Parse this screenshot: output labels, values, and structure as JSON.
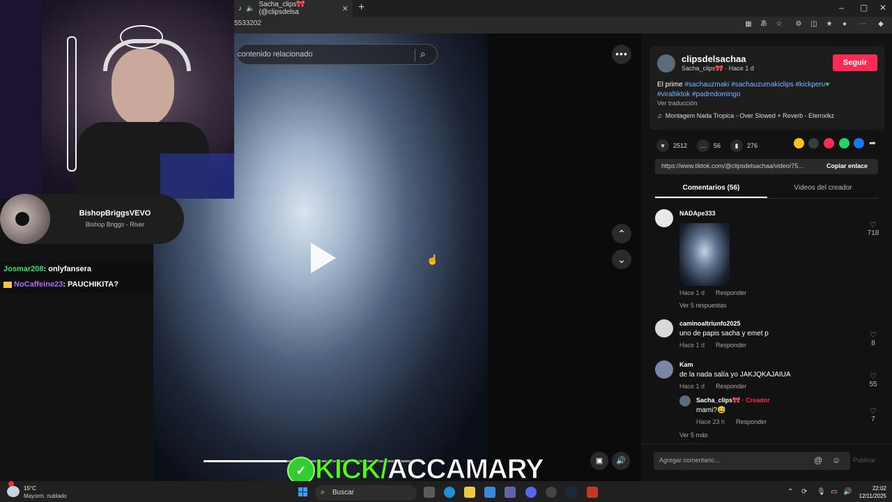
{
  "browser": {
    "tab_title": "Sacha_clips🎀 (@clipsdelsa",
    "new_tab_symbol": "+",
    "window_controls": [
      "–",
      "▢",
      "✕"
    ],
    "url_fragment": "5533202"
  },
  "video": {
    "search_placeholder": "contenido relacionado",
    "more_label": "•••",
    "nav_up": "⌃",
    "nav_down": "⌄",
    "progress_fraction": 0.39
  },
  "overlay": {
    "music_title": "BishopBriggsVEVO",
    "music_artist": "Bishop Briggs - River",
    "chat": [
      {
        "user": "Josmar208",
        "message": ": onlyfansera"
      },
      {
        "user": "NoCaffeine23",
        "message": ": PAUCHIKITA?"
      }
    ],
    "kick_prefix": "KICK/",
    "kick_channel": "ACCAMARY"
  },
  "post": {
    "author": "clipsdelsachaa",
    "author_sub": "Sacha_clips🎀 · Hace 1 d",
    "follow_label": "Seguir",
    "desc_text": "El prime ",
    "hashtags": [
      "#sachauzmaki",
      "#sachauzumakiclips",
      "#kickperu"
    ],
    "hashtags_line2": [
      "#viraltiktok",
      "#padredomingo"
    ],
    "translate_label": "Ver traducción",
    "music": "Montagem Nada Tropica - Over Slowed + Reverb - Eternxlkz",
    "likes": "2512",
    "comments": "56",
    "saves": "276",
    "link": "https://www.tiktok.com/@clipsdelsachaa/video/75...",
    "copy_label": "Copiar enlace",
    "tab_comments": "Comentarios (56)",
    "tab_videos": "Videos del creador"
  },
  "comments": [
    {
      "user": "NADApe333",
      "meta_time": "Hace 1 d",
      "reply": "Responder",
      "likes": "718",
      "more": "Ver 5 respuestas"
    },
    {
      "user": "caminoaltriunfo2025",
      "text": "uno de papis sacha y emet p",
      "meta_time": "Hace 1 d",
      "reply": "Responder",
      "likes": "8"
    },
    {
      "user": "Kam",
      "text": "de la nada salía yo JAKJQKAJAIUA",
      "meta_time": "Hace 1 d",
      "reply": "Responder",
      "likes": "55"
    },
    {
      "user": "Sacha_clips🎀",
      "creator_tag": " · Creador",
      "text": "mami?😅",
      "meta_time": "Hace 23 h",
      "reply": "Responder",
      "likes": "7",
      "more": "Ver 5 más"
    }
  ],
  "comment_box": {
    "placeholder": "Agregar comentario...",
    "publish_label": "Publicar"
  },
  "taskbar": {
    "temp": "15°C",
    "condition": "Mayorm. nublado",
    "search_label": "Buscar",
    "time": "22:02",
    "date": "12/11/2025"
  },
  "colors": {
    "accent": "#fe2c55",
    "hashtag": "#79b7ff",
    "kick_green": "#53fc18"
  }
}
